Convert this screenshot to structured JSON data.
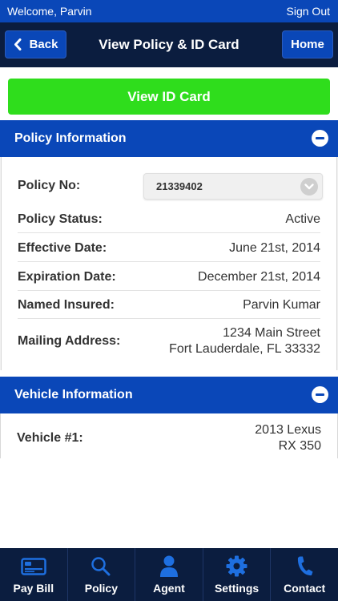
{
  "header": {
    "welcome": "Welcome, Parvin",
    "sign_out": "Sign Out"
  },
  "nav": {
    "back_label": "Back",
    "title": "View Policy & ID Card",
    "home_label": "Home"
  },
  "id_card_button": "View ID Card",
  "policy_section": {
    "title": "Policy Information",
    "policy_no_label": "Policy No:",
    "policy_no_value": "21339402",
    "status_label": "Policy Status:",
    "status_value": "Active",
    "effective_label": "Effective Date:",
    "effective_value": "June 21st, 2014",
    "expiration_label": "Expiration Date:",
    "expiration_value": "December 21st, 2014",
    "insured_label": "Named Insured:",
    "insured_value": "Parvin Kumar",
    "address_label": "Mailing Address:",
    "address_line1": "1234 Main Street",
    "address_line2": "Fort Lauderdale, FL 33332"
  },
  "vehicle_section": {
    "title": "Vehicle Information",
    "vehicle_label": "Vehicle #1:",
    "vehicle_line1": "2013 Lexus",
    "vehicle_line2": "RX 350"
  },
  "tabs": [
    {
      "label": "Pay Bill",
      "icon": "credit-card-icon"
    },
    {
      "label": "Policy",
      "icon": "search-icon"
    },
    {
      "label": "Agent",
      "icon": "person-icon"
    },
    {
      "label": "Settings",
      "icon": "gear-icon"
    },
    {
      "label": "Contact",
      "icon": "phone-icon"
    }
  ],
  "colors": {
    "primary_blue": "#0a47b8",
    "navy": "#0b1d3f",
    "accent_green": "#2fdd1c",
    "icon_blue": "#1e6fe0"
  }
}
